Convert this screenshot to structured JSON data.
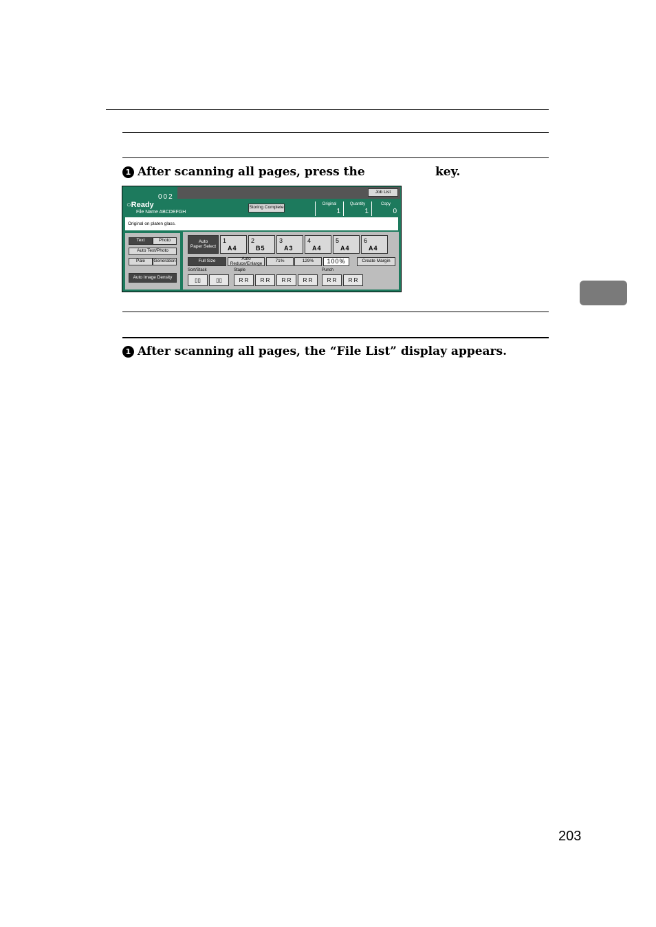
{
  "instructions": {
    "step1_bullet": "1",
    "step1_before": "After scanning all pages, press the",
    "step1_after": "key.",
    "step2_bullet": "1",
    "step2_text": "After scanning all pages, the “File List” display appears."
  },
  "page_number": "203",
  "copier_panel": {
    "counter": "002",
    "job_list_label": "Job List",
    "status": "Ready",
    "file_name": "File Name ABCDEFGH",
    "storing_complete_label": "Storing Complete",
    "counters": [
      {
        "label": "Original",
        "value": "1"
      },
      {
        "label": "Quantity",
        "value": "1"
      },
      {
        "label": "Copy",
        "value": "0"
      }
    ],
    "message": "Original on platen glass.",
    "modes": {
      "text": "Text",
      "photo": "Photo",
      "auto_text_photo": "Auto Text/Photo",
      "pale": "Pale",
      "generation": "Generation",
      "auto_image_density": "Auto Image Density"
    },
    "auto_paper_select": [
      "Auto",
      "Paper Select"
    ],
    "paper_trays": [
      {
        "tray": "1",
        "size": "A4"
      },
      {
        "tray": "2",
        "size": "B5"
      },
      {
        "tray": "3",
        "size": "A3"
      },
      {
        "tray": "4",
        "size": "A4"
      },
      {
        "tray": "5",
        "size": "A4"
      },
      {
        "tray": "6",
        "size": "A4"
      }
    ],
    "reduce_enlarge": {
      "full_size": "Full Size",
      "auto": "Auto Reduce/Enlarge",
      "r71": "71%",
      "r129": "129%",
      "current": "100%",
      "create_margin": "Create Margin"
    },
    "finishing": {
      "sort_stack": "Sort/Stack",
      "staple": "Staple",
      "punch": "Punch"
    }
  }
}
